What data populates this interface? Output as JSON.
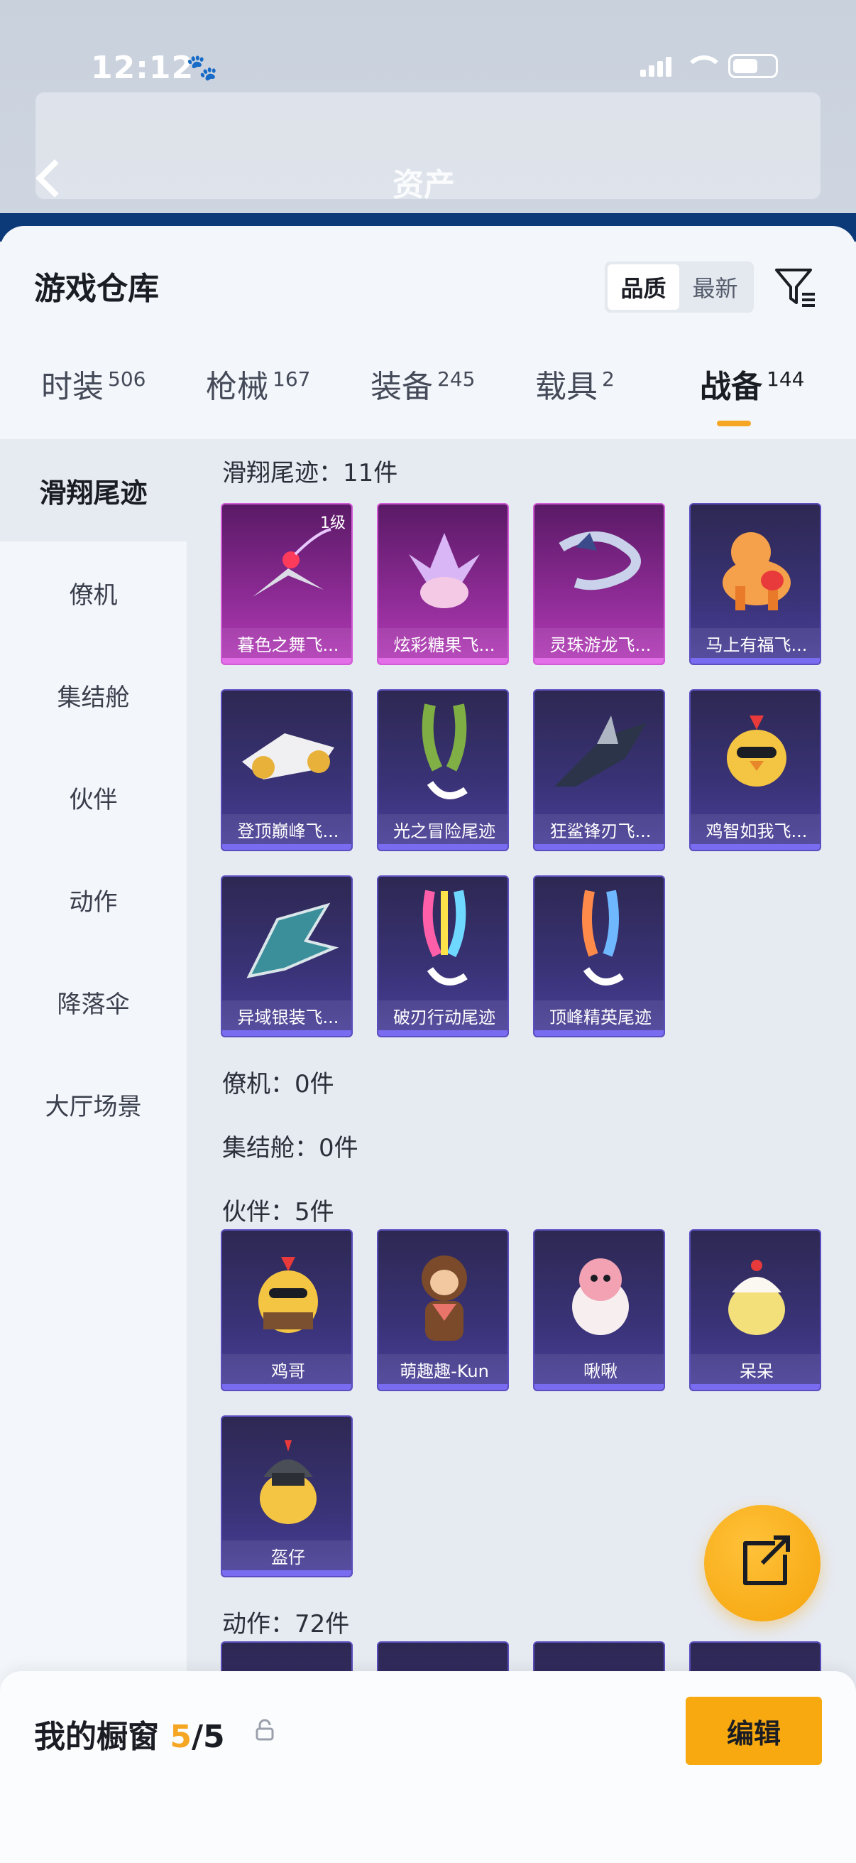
{
  "status": {
    "time": "12:12"
  },
  "backdrop": {
    "title": "资产"
  },
  "sheet": {
    "title": "游戏仓库",
    "sort_options": [
      "品质",
      "最新"
    ],
    "tabs": [
      {
        "label": "时装",
        "count": "506"
      },
      {
        "label": "枪械",
        "count": "167"
      },
      {
        "label": "装备",
        "count": "245"
      },
      {
        "label": "载具",
        "count": "2"
      },
      {
        "label": "战备",
        "count": "144"
      }
    ],
    "sidebar": [
      "滑翔尾迹",
      "僚机",
      "集结舱",
      "伙伴",
      "动作",
      "降落伞",
      "大厅场景"
    ],
    "sections": {
      "glide": {
        "header": "滑翔尾迹：11件"
      },
      "wingman": {
        "header": "僚机：0件"
      },
      "pod": {
        "header": "集结舱：0件"
      },
      "partner": {
        "header": "伙伴：5件"
      },
      "action": {
        "header": "动作：72件"
      }
    },
    "glide_items": [
      {
        "name": "暮色之舞飞...",
        "level": "1级"
      },
      {
        "name": "炫彩糖果飞..."
      },
      {
        "name": "灵珠游龙飞..."
      },
      {
        "name": "马上有福飞..."
      },
      {
        "name": "登顶巅峰飞..."
      },
      {
        "name": "光之冒险尾迹"
      },
      {
        "name": "狂鲨锋刃飞..."
      },
      {
        "name": "鸡智如我飞..."
      },
      {
        "name": "异域银装飞..."
      },
      {
        "name": "破刃行动尾迹"
      },
      {
        "name": "顶峰精英尾迹"
      }
    ],
    "partner_items": [
      {
        "name": "鸡哥"
      },
      {
        "name": "萌趣趣-Kun"
      },
      {
        "name": "啾啾"
      },
      {
        "name": "呆呆"
      },
      {
        "name": "盔仔"
      }
    ]
  },
  "bottom": {
    "label": "我的橱窗",
    "current": "5",
    "total": "/5",
    "edit_label": "编辑"
  },
  "colors": {
    "accent": "#f5a623",
    "edit_button": "#f7a90f",
    "card_purple": "#b43cb8",
    "card_blue": "#3a3378"
  }
}
